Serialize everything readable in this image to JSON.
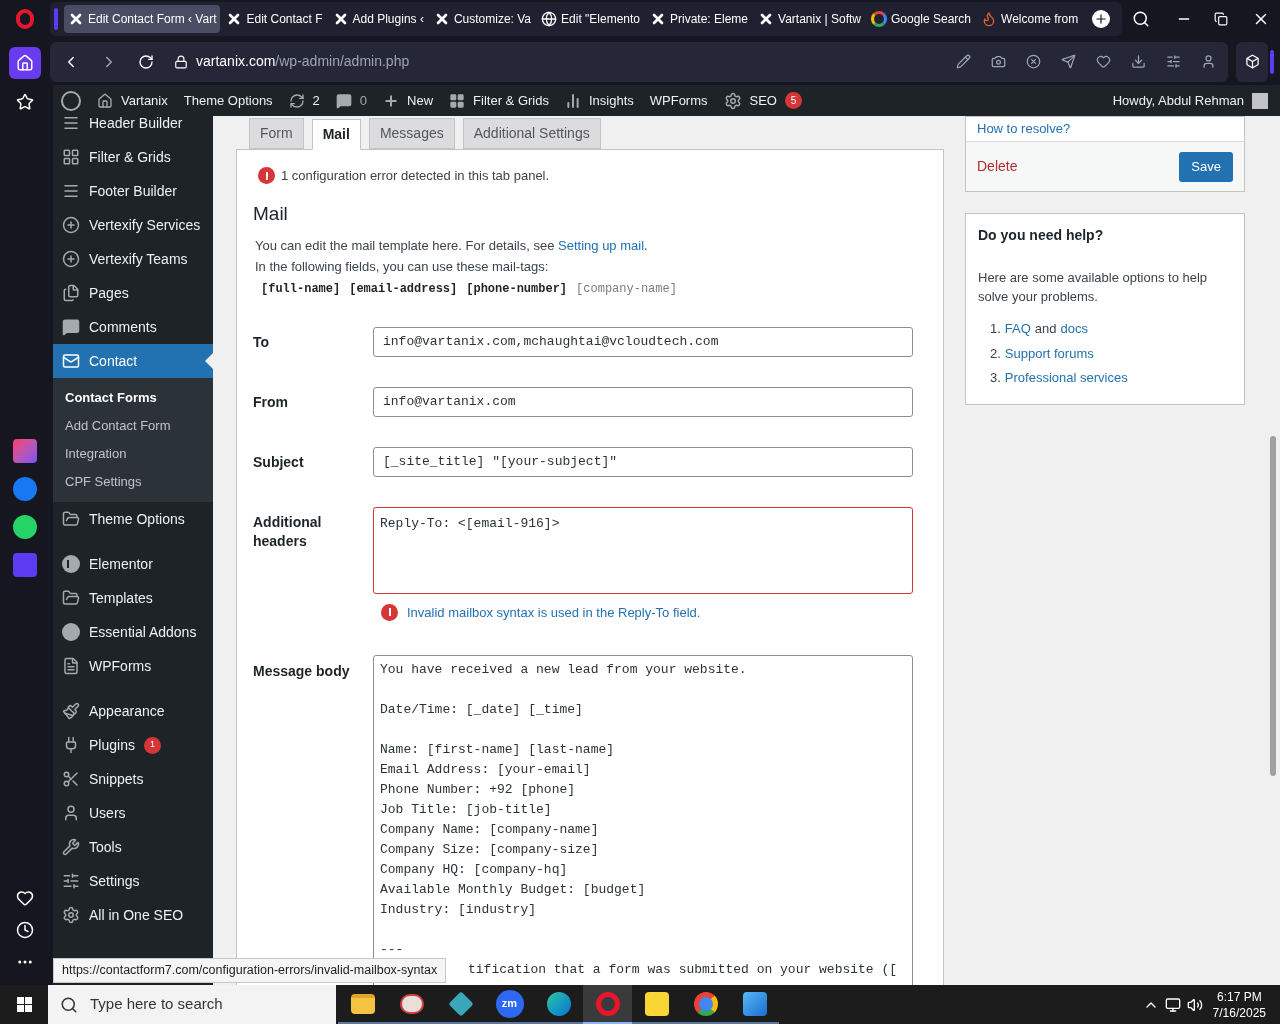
{
  "browser_tabs": [
    {
      "title": "Edit Contact Form ‹ Vart",
      "kind": "x",
      "selected": true
    },
    {
      "title": "Edit Contact F",
      "kind": "x",
      "selected": false
    },
    {
      "title": "Add Plugins ‹",
      "kind": "x",
      "selected": false
    },
    {
      "title": "Customize: Va",
      "kind": "x",
      "selected": false
    },
    {
      "title": "Edit \"Elemento",
      "kind": "wp",
      "selected": false
    },
    {
      "title": "Private: Eleme",
      "kind": "x",
      "selected": false
    },
    {
      "title": "Vartanix | Softw",
      "kind": "x",
      "selected": false
    },
    {
      "title": "Google Search",
      "kind": "google",
      "selected": false
    },
    {
      "title": "Welcome from",
      "kind": "fire",
      "selected": false
    }
  ],
  "address_bar": {
    "host": "vartanix.com",
    "path": "/wp-admin/admin.php"
  },
  "admin_bar": {
    "site": "Vartanix",
    "theme_options": "Theme Options",
    "updates": "2",
    "comments": "0",
    "new": "New",
    "filter_grids": "Filter & Grids",
    "insights": "Insights",
    "wpforms": "WPForms",
    "seo": "SEO",
    "seo_badge": "5",
    "howdy": "Howdy, Abdul Rehman"
  },
  "sidebar": {
    "groups": [
      [
        {
          "label": "Header Builder",
          "kind": "bars"
        },
        {
          "label": "Filter & Grids",
          "kind": "grid"
        },
        {
          "label": "Footer Builder",
          "kind": "bars"
        },
        {
          "label": "Vertexify Services",
          "kind": "plus"
        },
        {
          "label": "Vertexify Teams",
          "kind": "plus"
        },
        {
          "label": "Pages",
          "kind": "pages"
        },
        {
          "label": "Comments",
          "kind": "comment"
        },
        {
          "label": "Contact",
          "kind": "mail",
          "selected": true,
          "children": [
            {
              "label": "Contact Forms",
              "selected": true
            },
            {
              "label": "Add Contact Form",
              "selected": false
            },
            {
              "label": "Integration",
              "selected": false
            },
            {
              "label": "CPF Settings",
              "selected": false
            }
          ]
        },
        {
          "label": "Theme Options",
          "kind": "folder"
        }
      ],
      [
        {
          "label": "Elementor",
          "kind": "elementor"
        },
        {
          "label": "Templates",
          "kind": "folder"
        },
        {
          "label": "Essential Addons",
          "kind": "ea"
        },
        {
          "label": "WPForms",
          "kind": "form"
        }
      ],
      [
        {
          "label": "Appearance",
          "kind": "brush"
        },
        {
          "label": "Plugins",
          "kind": "plug",
          "badge": "1"
        },
        {
          "label": "Snippets",
          "kind": "scissors"
        },
        {
          "label": "Users",
          "kind": "user"
        },
        {
          "label": "Tools",
          "kind": "wrench"
        },
        {
          "label": "Settings",
          "kind": "sliders"
        },
        {
          "label": "All in One SEO",
          "kind": "gear"
        }
      ]
    ]
  },
  "form_tabs": [
    {
      "label": "Form",
      "selected": false
    },
    {
      "label": "Mail",
      "selected": true
    },
    {
      "label": "Messages",
      "selected": false
    },
    {
      "label": "Additional Settings",
      "selected": false
    }
  ],
  "panel": {
    "notice": "1 configuration error detected in this tab panel.",
    "heading": "Mail",
    "intro": "You can edit the mail template here. For details, see",
    "intro_link": "Setting up mail",
    "intro_end": ".",
    "tags_intro": "In the following fields, you can use these mail-tags:",
    "tags": [
      {
        "text": "[full-name]",
        "used": true
      },
      {
        "text": "[email-address]",
        "used": true
      },
      {
        "text": "[phone-number]",
        "used": true
      },
      {
        "text": "[company-name]",
        "used": false
      }
    ],
    "fields": [
      {
        "label": "To",
        "kind": "input",
        "value": "info@vartanix.com,mchaughtai@vcloudtech.com",
        "error": false
      },
      {
        "label": "From",
        "kind": "input",
        "value": "info@vartanix.com",
        "error": false
      },
      {
        "label": "Subject",
        "kind": "input",
        "value": "[_site_title] \"[your-subject]\"",
        "error": false
      },
      {
        "label": "Additional headers",
        "kind": "textarea",
        "value": "Reply-To: <[email-916]>",
        "error": true,
        "error_text": "Invalid mailbox syntax is used in the Reply-To field."
      }
    ],
    "body_label": "Message body",
    "body_text": "You have received a new lead from your website.\n\nDate/Time: [_date] [_time]\n\nName: [first-name] [last-name]\nEmail Address: [your-email]\nPhone Number: +92 [phone]\nJob Title: [job-title]\nCompany Name: [company-name]\nCompany Size: [company-size]\nCompany HQ: [company-hq]\nAvailable Monthly Budget: [budget]\nIndustry: [industry]\n\n---",
    "body_cut_line": "tification that a form was submitted on your website (["
  },
  "actions": {
    "resolve": "How to resolve?",
    "delete": "Delete",
    "save": "Save"
  },
  "help": {
    "title": "Do you need help?",
    "text": "Here are some available options to help solve your problems.",
    "items": [
      {
        "num": "1.",
        "links": [
          "FAQ",
          "docs"
        ],
        "joiner": "and"
      },
      {
        "num": "2.",
        "links": [
          "Support forums"
        ]
      },
      {
        "num": "3.",
        "links": [
          "Professional services"
        ]
      }
    ]
  },
  "status_url": "https://contactform7.com/configuration-errors/invalid-mailbox-syntax",
  "taskbar": {
    "search": "Type here to search",
    "apps": [
      {
        "kind": "folder",
        "selected": false
      },
      {
        "kind": "paint",
        "selected": false
      },
      {
        "kind": "hexagon",
        "selected": false
      },
      {
        "kind": "zoom",
        "label": "zm",
        "selected": false
      },
      {
        "kind": "edge",
        "selected": false
      },
      {
        "kind": "opera",
        "selected": true
      },
      {
        "kind": "sticky",
        "selected": false
      },
      {
        "kind": "chrome",
        "selected": false
      },
      {
        "kind": "photos",
        "selected": false
      }
    ],
    "time": "6:17 PM",
    "date": "7/16/2025"
  }
}
